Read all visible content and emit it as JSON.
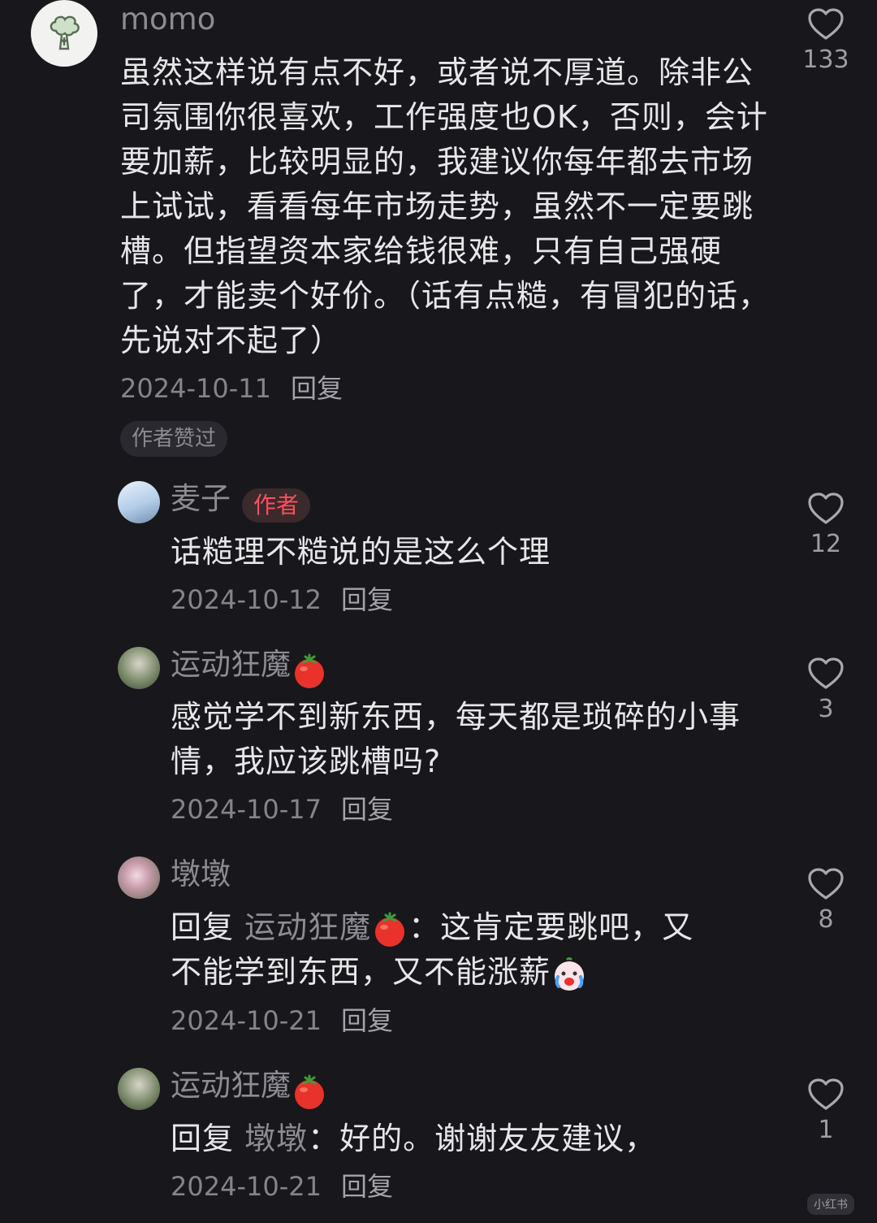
{
  "comments": {
    "main": {
      "username": "momo",
      "text": "虽然这样说有点不好，或者说不厚道。除非公司氛围你很喜欢，工作强度也OK，否则，会计要加薪，比较明显的，我建议你每年都去市场上试试，看看每年市场走势，虽然不一定要跳槽。但指望资本家给钱很难，只有自己强硬了，才能卖个好价。（话有点糙，有冒犯的话，先说对不起了）",
      "date": "2024-10-11",
      "reply_label": "回复",
      "liked_badge": "作者赞过",
      "likes": "133"
    },
    "replies": [
      {
        "username": "麦子",
        "author_badge": "作者",
        "text": "话糙理不糙说的是这么个理",
        "date": "2024-10-12",
        "reply_label": "回复",
        "likes": "12"
      },
      {
        "username": "运动狂魔",
        "text": "感觉学不到新东西，每天都是琐碎的小事情，我应该跳槽吗?",
        "date": "2024-10-17",
        "reply_label": "回复",
        "likes": "3"
      },
      {
        "username": "墩墩",
        "prefix": "回复",
        "mention": "运动狂魔",
        "text_a": "：这肯定要跳吧，又",
        "text_b": "不能学到东西，又不能涨薪",
        "date": "2024-10-21",
        "reply_label": "回复",
        "likes": "8"
      },
      {
        "username": "运动狂魔",
        "prefix": "回复",
        "mention": "墩墩",
        "text_a": "：好的。谢谢友友建议，",
        "date": "2024-10-21",
        "reply_label": "回复",
        "likes": "1"
      }
    ]
  },
  "watermark": "小红书"
}
